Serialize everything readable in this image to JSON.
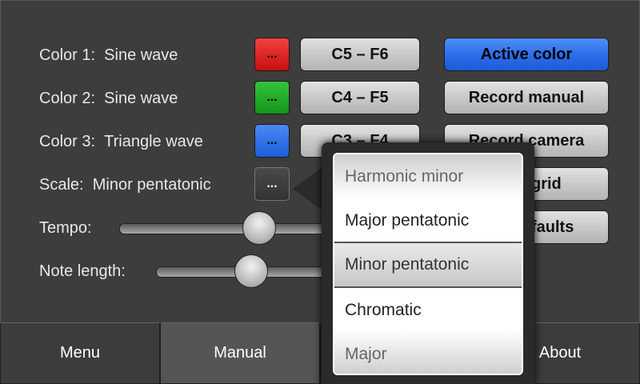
{
  "rows": [
    {
      "label": "Color 1:",
      "value": "Sine wave",
      "swatch": "...",
      "swatch_color": "#e02424",
      "range": "C5 – F6"
    },
    {
      "label": "Color 2:",
      "value": "Sine wave",
      "swatch": "...",
      "swatch_color": "#22aa28",
      "range": "C4 – F5"
    },
    {
      "label": "Color 3:",
      "value": "Triangle wave",
      "swatch": "...",
      "swatch_color": "#2e74ea",
      "range": "C3 – F4"
    }
  ],
  "scale": {
    "label": "Scale:",
    "value": "Minor pentatonic",
    "button": "..."
  },
  "tempo": {
    "label": "Tempo:",
    "level": 0.6
  },
  "note_length": {
    "label": "Note length:",
    "level": 0.5
  },
  "right_buttons": {
    "active_color": "Active color",
    "record_manual": "Record manual",
    "record_camera": "Record camera",
    "grid": "grid",
    "defaults": "faults"
  },
  "picker": {
    "items": [
      "Harmonic minor",
      "Major pentatonic",
      "Minor pentatonic",
      "Chromatic",
      "Major"
    ],
    "selected": "Minor pentatonic"
  },
  "nav": {
    "menu": "Menu",
    "manual": "Manual",
    "about": "About"
  },
  "colors": {
    "accent": "#2b6ce8",
    "background": "#3d3d3d"
  }
}
